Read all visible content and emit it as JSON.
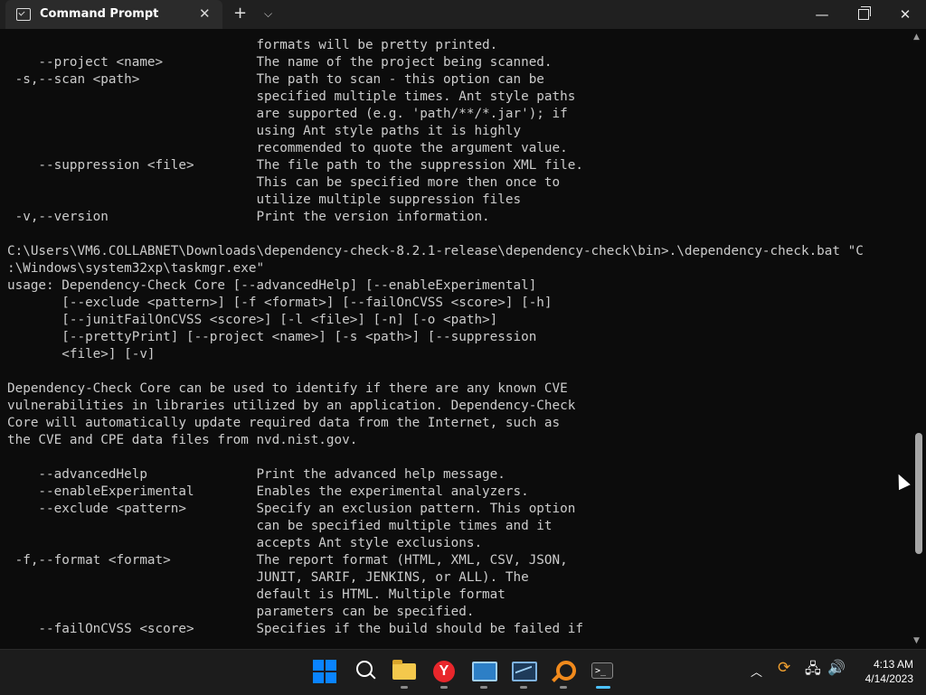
{
  "window": {
    "tab_title": "Command Prompt",
    "tab_icon": "cmd-icon",
    "new_tab_glyph": "+",
    "dropdown_glyph": "⌵",
    "close_tab_glyph": "✕",
    "minimize_glyph": "—",
    "close_glyph": "✕"
  },
  "terminal": {
    "lines": [
      "                                formats will be pretty printed.",
      "    --project <name>            The name of the project being scanned.",
      " -s,--scan <path>               The path to scan - this option can be",
      "                                specified multiple times. Ant style paths",
      "                                are supported (e.g. 'path/**/*.jar'); if",
      "                                using Ant style paths it is highly",
      "                                recommended to quote the argument value.",
      "    --suppression <file>        The file path to the suppression XML file.",
      "                                This can be specified more then once to",
      "                                utilize multiple suppression files",
      " -v,--version                   Print the version information.",
      "",
      "C:\\Users\\VM6.COLLABNET\\Downloads\\dependency-check-8.2.1-release\\dependency-check\\bin>.\\dependency-check.bat \"C",
      ":\\Windows\\system32xp\\taskmgr.exe\"",
      "usage: Dependency-Check Core [--advancedHelp] [--enableExperimental]",
      "       [--exclude <pattern>] [-f <format>] [--failOnCVSS <score>] [-h]",
      "       [--junitFailOnCVSS <score>] [-l <file>] [-n] [-o <path>]",
      "       [--prettyPrint] [--project <name>] [-s <path>] [--suppression",
      "       <file>] [-v]",
      "",
      "Dependency-Check Core can be used to identify if there are any known CVE",
      "vulnerabilities in libraries utilized by an application. Dependency-Check",
      "Core will automatically update required data from the Internet, such as",
      "the CVE and CPE data files from nvd.nist.gov.",
      "",
      "    --advancedHelp              Print the advanced help message.",
      "    --enableExperimental        Enables the experimental analyzers.",
      "    --exclude <pattern>         Specify an exclusion pattern. This option",
      "                                can be specified multiple times and it",
      "                                accepts Ant style exclusions.",
      " -f,--format <format>           The report format (HTML, XML, CSV, JSON,",
      "                                JUNIT, SARIF, JENKINS, or ALL). The",
      "                                default is HTML. Multiple format",
      "                                parameters can be specified.",
      "    --failOnCVSS <score>        Specifies if the build should be failed if"
    ],
    "text": ""
  },
  "scrollbar": {
    "up_glyph": "▲",
    "down_glyph": "▼",
    "position_fraction": 0.67
  },
  "taskbar": {
    "apps": [
      {
        "name": "start-icon"
      },
      {
        "name": "search-icon"
      },
      {
        "name": "file-explorer-icon"
      },
      {
        "name": "yandex-browser-icon",
        "glyph": "Y"
      },
      {
        "name": "remote-desktop-icon"
      },
      {
        "name": "resource-monitor-icon"
      },
      {
        "name": "search-tool-icon"
      },
      {
        "name": "terminal-icon",
        "glyph": ">_"
      }
    ],
    "tray": {
      "chevron_glyph": "︿",
      "sync_glyph": "⟳",
      "network_glyph": "🖧",
      "volume_glyph": "🔊"
    },
    "clock": {
      "time": "4:13 AM",
      "date": "4/14/2023"
    }
  }
}
